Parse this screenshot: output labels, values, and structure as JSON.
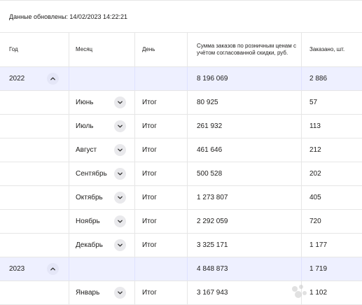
{
  "updated_label": "Данные обновлены: 14/02/2023 14:22:21",
  "columns": {
    "year": "Год",
    "month": "Месяц",
    "day": "День",
    "sum": "Сумма заказов по розничным ценам с учётом согласованной скидки, руб.",
    "ordered": "Заказано, шт."
  },
  "rows": [
    {
      "kind": "year",
      "year": "2022",
      "sum": "8 196 069",
      "ordered": "2 886",
      "toggle": "chevron-up-icon"
    },
    {
      "kind": "month",
      "month": "Июнь",
      "day": "Итог",
      "sum": "80 925",
      "ordered": "57",
      "toggle": "chevron-down-icon"
    },
    {
      "kind": "month",
      "month": "Июль",
      "day": "Итог",
      "sum": "261 932",
      "ordered": "113",
      "toggle": "chevron-down-icon"
    },
    {
      "kind": "month",
      "month": "Август",
      "day": "Итог",
      "sum": "461 646",
      "ordered": "212",
      "toggle": "chevron-down-icon"
    },
    {
      "kind": "month",
      "month": "Сентябрь",
      "day": "Итог",
      "sum": "500 528",
      "ordered": "202",
      "toggle": "chevron-down-icon"
    },
    {
      "kind": "month",
      "month": "Октябрь",
      "day": "Итог",
      "sum": "1 273 807",
      "ordered": "405",
      "toggle": "chevron-down-icon"
    },
    {
      "kind": "month",
      "month": "Ноябрь",
      "day": "Итог",
      "sum": "2 292 059",
      "ordered": "720",
      "toggle": "chevron-down-icon"
    },
    {
      "kind": "month",
      "month": "Декабрь",
      "day": "Итог",
      "sum": "3 325 171",
      "ordered": "1 177",
      "toggle": "chevron-down-icon"
    },
    {
      "kind": "year",
      "year": "2023",
      "sum": "4 848 873",
      "ordered": "1 719",
      "toggle": "chevron-up-icon"
    },
    {
      "kind": "month",
      "month": "Январь",
      "day": "Итог",
      "sum": "3 167 943",
      "ordered": "1 102",
      "toggle": "chevron-down-icon"
    }
  ],
  "watermark": "Avito",
  "colors": {
    "year_row_bg": "#eef0ff",
    "border": "#e6e6e6",
    "toggle_bg": "#e9e9ec"
  }
}
